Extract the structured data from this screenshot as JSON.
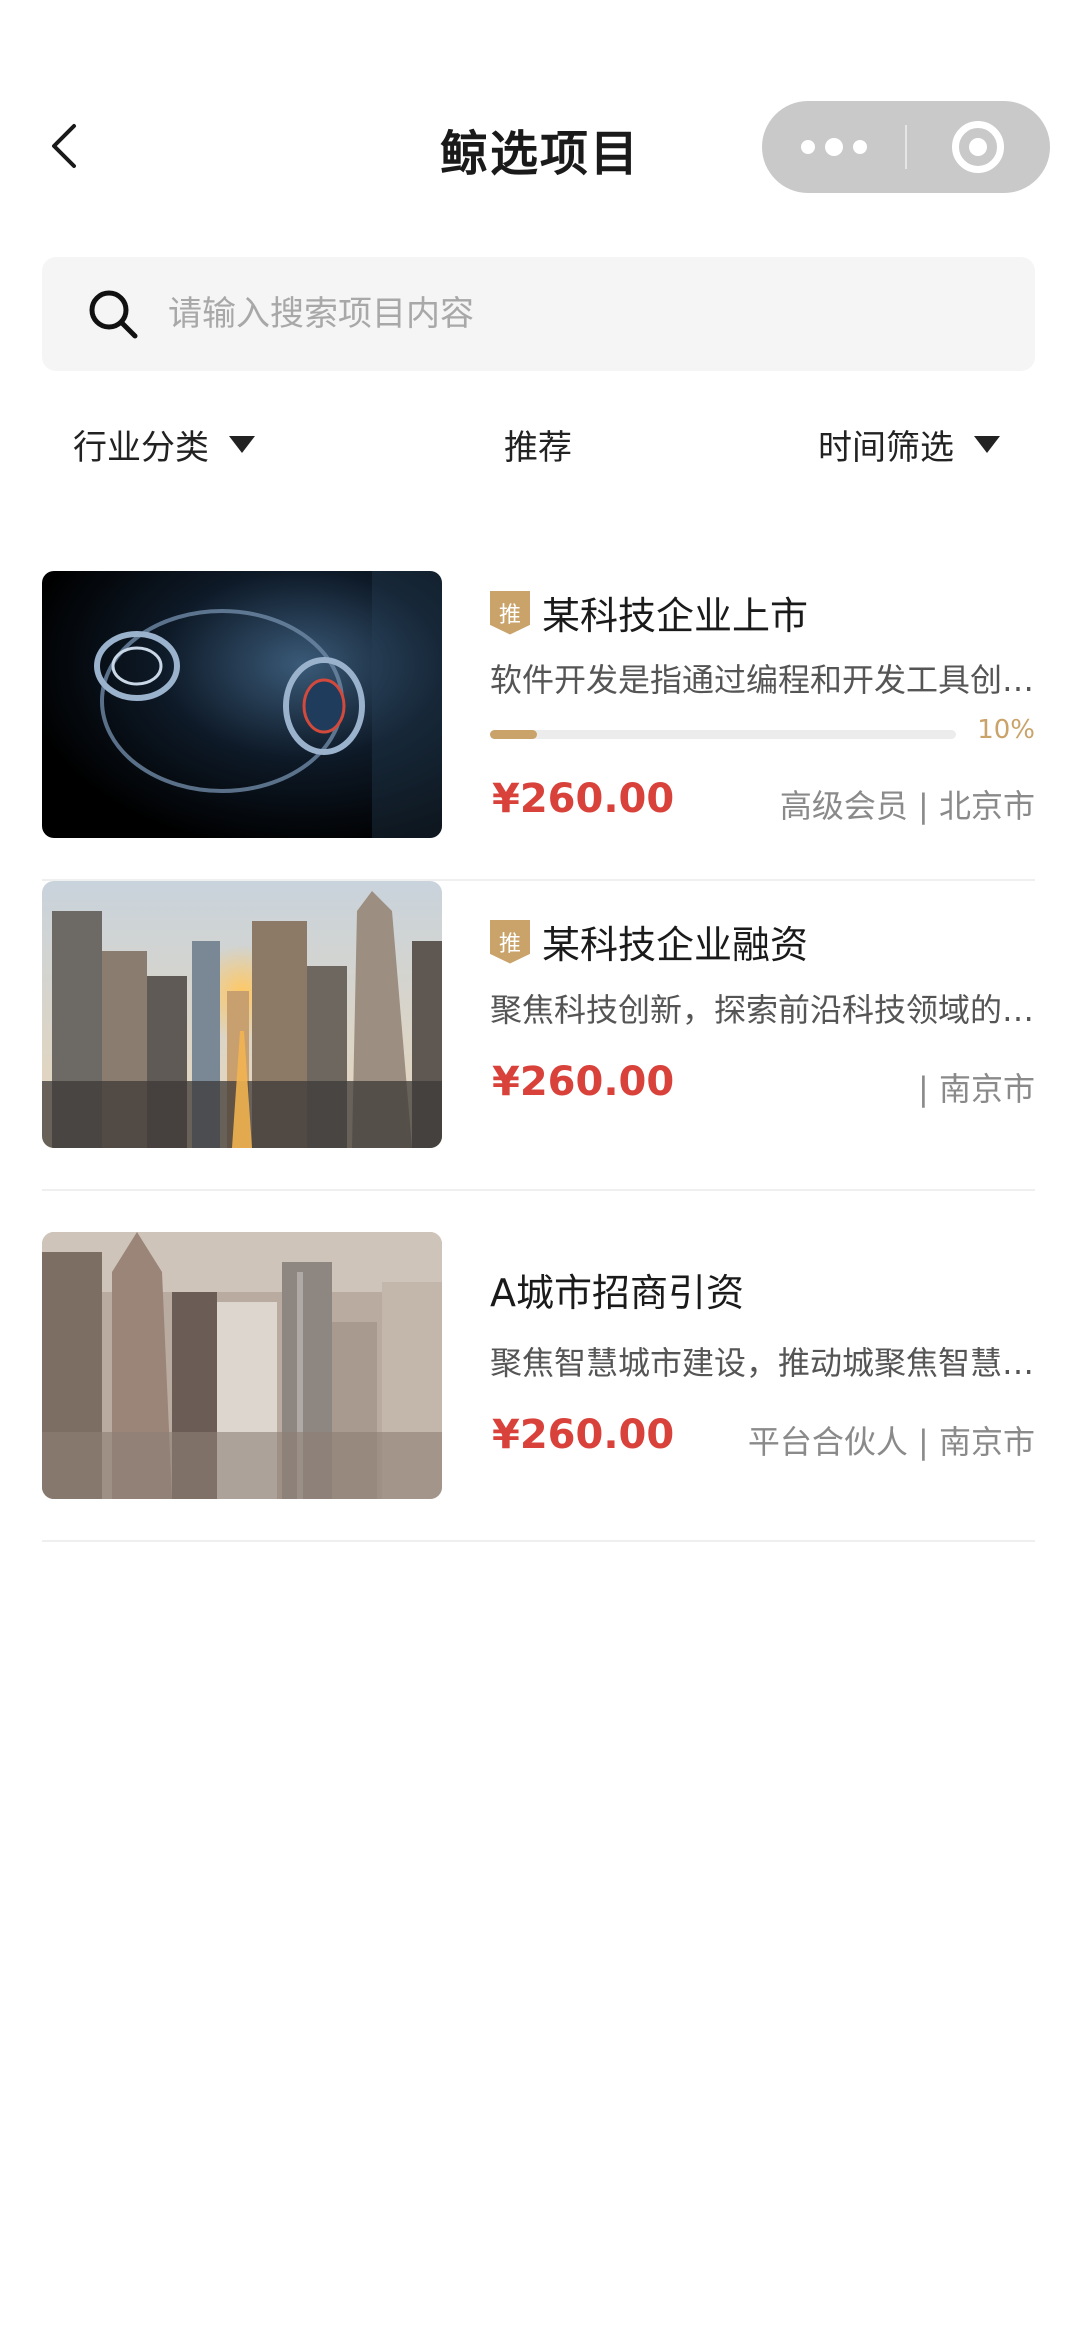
{
  "nav": {
    "title": "鲸选项目",
    "back_icon": "chevron-left-icon",
    "more_icon": "more-dots-icon",
    "close_icon": "target-close-icon"
  },
  "search": {
    "placeholder": "请输入搜索项目内容",
    "value": "",
    "icon": "search-icon"
  },
  "filters": [
    {
      "label": "行业分类",
      "has_dropdown": true
    },
    {
      "label": "推荐",
      "has_dropdown": false
    },
    {
      "label": "时间筛选",
      "has_dropdown": true
    }
  ],
  "items": [
    {
      "tag": "推",
      "title": "某科技企业上市",
      "desc": "软件开发是指通过编程和开发工具创建软件应用程序的过程",
      "progress_label": "10%",
      "progress": 0.1,
      "price": "¥260.00",
      "meta": "高级会员 | 北京市"
    },
    {
      "tag": "推",
      "title": "某科技企业融资",
      "desc": "聚焦科技创新，探索前沿科技领域的无限可能",
      "price": "¥260.00",
      "meta": "| 南京市"
    },
    {
      "title": "A城市招商引资",
      "desc": "聚焦智慧城市建设，推动城聚焦智慧城市建设",
      "price": "¥260.00",
      "meta": "平台合伙人 | 南京市"
    }
  ],
  "colors": {
    "accent_gold": "#c9a36a",
    "price_red": "#d9413b",
    "search_bg": "#f5f5f5",
    "capsule_bg": "#c9c9c9"
  }
}
